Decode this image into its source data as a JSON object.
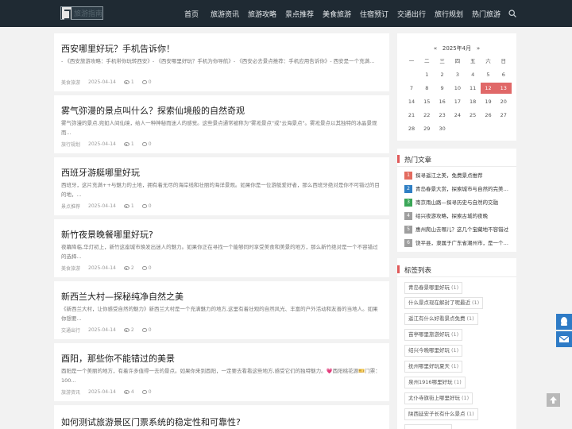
{
  "header": {
    "logo_text": "旅游指南",
    "nav": [
      "首页",
      "旅游资讯",
      "旅游攻略",
      "景点推荐",
      "美食旅游",
      "住宿预订",
      "交通出行",
      "旅行规划",
      "热门旅游"
    ]
  },
  "articles": [
    {
      "title": "西安哪里好玩？手机告诉你！",
      "excerpt": "- 《西安旅游攻略：手机带你玩转西安》- 《西安哪里好玩？手机为你导航》- 《西安必去景点推荐：手机应用告诉你》- 西安是一个充满...",
      "category": "美食旅游",
      "date": "2025-04-14",
      "views": "1",
      "comments": "0"
    },
    {
      "title": "雾气弥漫的景点叫什么？探索仙境般的自然奇观",
      "excerpt": "雾气弥漫的景点,宛如人间仙境，给人一种神秘而迷人的感觉。这些景点通常被称为\"雾凇景点\"或\"云海景点\"。雾凇景点以其独特的冰晶景观而...",
      "category": "旅行规划",
      "date": "2025-04-14",
      "views": "1",
      "comments": "0"
    },
    {
      "title": "西班牙游艇哪里好玩",
      "excerpt": "西班牙，这片充满++与魅力的土地，拥有着无尽的海岸线和壮丽的海洋景观。如果你是一位游艇爱好者，那么西班牙绝对是你不可错过的目的地，...",
      "category": "景点推荐",
      "date": "2025-04-14",
      "views": "1",
      "comments": "0"
    },
    {
      "title": "新竹夜景晚餐哪里好玩?",
      "excerpt": "夜幕降临,华灯初上，新竹这座城市焕发出迷人的魅力。如果你正在寻找一个能够同时享受美食和美景的地方，那么新竹绝对是一个不容错过的选择...",
      "category": "美食旅游",
      "date": "2025-04-14",
      "views": "2",
      "comments": "0"
    },
    {
      "title": "新西兰大村—探秘纯净自然之美",
      "excerpt": "《新西兰大村，让你感受自然的魅力》新西兰大村是一个充满魅力的地方,这里有着壮观的自然风光、丰富的户外活动和友善的当地人。如果你想要...",
      "category": "交通出行",
      "date": "2025-04-14",
      "views": "2",
      "comments": "0"
    },
    {
      "title": "酉阳，那些你不能错过的美景",
      "excerpt": "酉阳是一个美丽的地方，有着许多值得一去的景点。如果你来到酉阳，一定要去看看这些地方,感受它们的独特魅力。💗酉阳桃花源🎫门票：100...",
      "category": "旅游资讯",
      "date": "2025-04-14",
      "views": "4",
      "comments": "0"
    },
    {
      "title": "如何测试旅游景区门票系统的稳定性和可靠性?",
      "excerpt": "",
      "category": "",
      "date": "",
      "views": "",
      "comments": ""
    }
  ],
  "calendar": {
    "prev": "«",
    "month_label": "2025年4月",
    "next": "»",
    "weekdays": [
      "一",
      "二",
      "三",
      "四",
      "五",
      "六",
      "日"
    ],
    "rows": [
      [
        "",
        "1",
        "2",
        "3",
        "4",
        "5",
        "6"
      ],
      [
        "7",
        "8",
        "9",
        "10",
        "11",
        "12",
        "13"
      ],
      [
        "14",
        "15",
        "16",
        "17",
        "18",
        "19",
        "20"
      ],
      [
        "21",
        "22",
        "23",
        "24",
        "25",
        "26",
        "27"
      ],
      [
        "28",
        "29",
        "30",
        "",
        "",
        "",
        ""
      ]
    ],
    "highlighted": [
      "12",
      "13"
    ]
  },
  "hot": {
    "title": "热门文章",
    "items": [
      {
        "rank": "1",
        "text": "探寻遥江之美，免费景点推荐",
        "color": "#e36b5f"
      },
      {
        "rank": "2",
        "text": "青岛春景大赏，探索城市与自然的完美融合",
        "color": "#2f7fc4"
      },
      {
        "rank": "3",
        "text": "南京雨山路—探寻历史与自然的交融",
        "color": "#3aa657"
      },
      {
        "rank": "4",
        "text": "绍兴夜游攻略，探索古城的夜晚",
        "color": "#9e9e9e"
      },
      {
        "rank": "5",
        "text": "惠州爬山去哪儿？这几个宝藏地不容错过",
        "color": "#9e9e9e"
      },
      {
        "rank": "6",
        "text": "饶平县，隶属于广东省潮州市，是一个充满魅力的地方",
        "color": "#9e9e9e"
      }
    ]
  },
  "tags": {
    "title": "标签列表",
    "items": [
      {
        "label": "青岛春景哪里好玩",
        "count": "(1)"
      },
      {
        "label": "什么景点现在解封了呢最近",
        "count": "(1)"
      },
      {
        "label": "遥江有什么好看景点免费",
        "count": "(1)"
      },
      {
        "label": "苗亭哪里旅游好玩",
        "count": "(1)"
      },
      {
        "label": "绍兴今晚哪里好玩",
        "count": "(1)"
      },
      {
        "label": "抚州哪里好玩夏天",
        "count": "(1)"
      },
      {
        "label": "泉州1916哪里好玩",
        "count": "(1)"
      },
      {
        "label": "太仆寺旗街上哪里好玩",
        "count": "(1)"
      },
      {
        "label": "陕西延安子长有什么景点",
        "count": "(1)"
      },
      {
        "label": "",
        "count": ""
      }
    ]
  },
  "colors": {
    "header_bg": "#1f2a33",
    "accent": "#e05a5a",
    "float_btn": "#2e7bc6"
  }
}
